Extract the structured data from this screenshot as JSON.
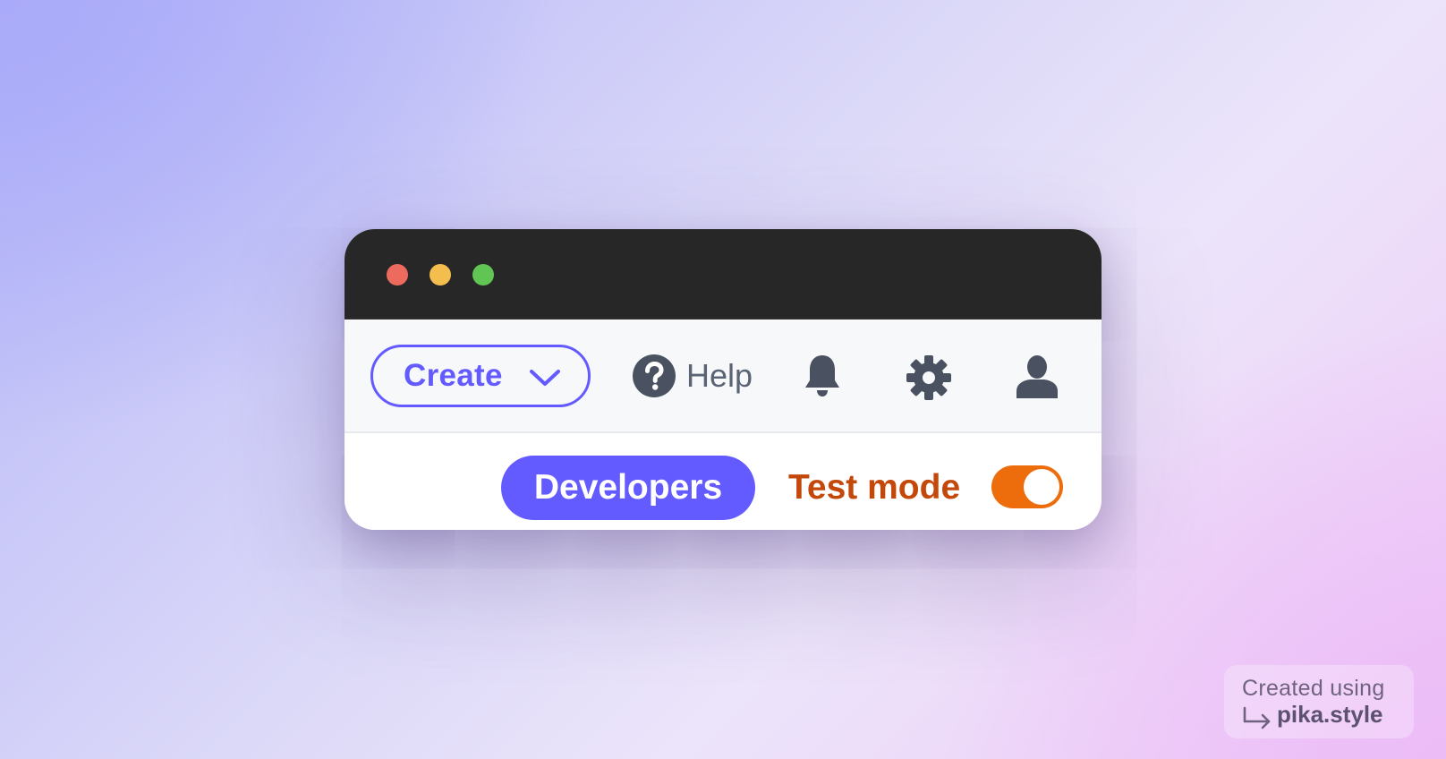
{
  "window": {
    "controls": [
      "close",
      "minimize",
      "zoom"
    ]
  },
  "toolbar": {
    "create_label": "Create",
    "create_icon": "chevron-down-icon",
    "help_label": "Help",
    "help_icon": "question-circle-icon",
    "notifications_icon": "bell-icon",
    "settings_icon": "gear-icon",
    "account_icon": "user-icon"
  },
  "subbar": {
    "developers_label": "Developers",
    "test_mode_label": "Test mode",
    "test_mode_on": true
  },
  "watermark": {
    "line1": "Created using",
    "line2": "pika.style"
  },
  "colors": {
    "accent": "#635bff",
    "test_mode": "#c4480a",
    "toggle": "#ed6c0b",
    "icon": "#4a5262",
    "titlebar": "#272727"
  }
}
